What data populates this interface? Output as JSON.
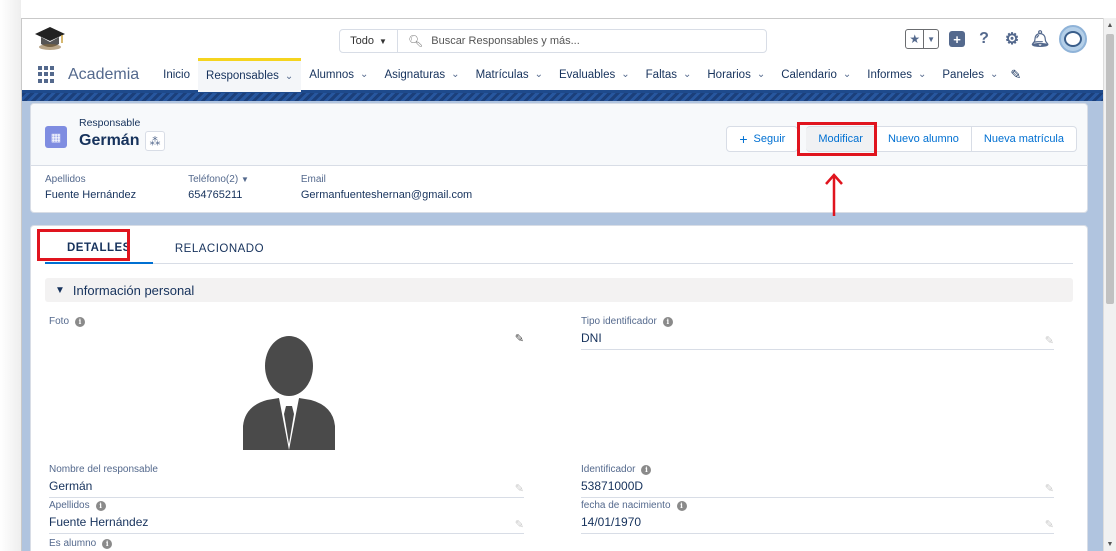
{
  "header": {
    "search_scope": "Todo",
    "search_placeholder": "Buscar Responsables y más..."
  },
  "nav": {
    "app_name": "Academia",
    "items": [
      {
        "label": "Inicio",
        "has_menu": false,
        "active": false
      },
      {
        "label": "Responsables",
        "has_menu": true,
        "active": true
      },
      {
        "label": "Alumnos",
        "has_menu": true,
        "active": false
      },
      {
        "label": "Asignaturas",
        "has_menu": true,
        "active": false
      },
      {
        "label": "Matrículas",
        "has_menu": true,
        "active": false
      },
      {
        "label": "Evaluables",
        "has_menu": true,
        "active": false
      },
      {
        "label": "Faltas",
        "has_menu": true,
        "active": false
      },
      {
        "label": "Horarios",
        "has_menu": true,
        "active": false
      },
      {
        "label": "Calendario",
        "has_menu": true,
        "active": false
      },
      {
        "label": "Informes",
        "has_menu": true,
        "active": false
      },
      {
        "label": "Paneles",
        "has_menu": true,
        "active": false
      }
    ]
  },
  "record": {
    "object_type": "Responsable",
    "name": "Germán",
    "actions": {
      "follow": "Seguir",
      "modify": "Modificar",
      "new_student": "Nuevo alumno",
      "new_enrollment": "Nueva matrícula"
    },
    "highlights": [
      {
        "label": "Apellidos",
        "value": "Fuente Hernández"
      },
      {
        "label": "Teléfono(2)",
        "value": "654765211"
      },
      {
        "label": "Email",
        "value": "Germanfuenteshernan@gmail.com"
      }
    ]
  },
  "tabs": {
    "details": "DETALLES",
    "related": "RELACIONADO"
  },
  "section": {
    "title": "Información personal"
  },
  "fields": {
    "photo_label": "Foto",
    "id_type_label": "Tipo identificador",
    "id_type_value": "DNI",
    "name_label": "Nombre del responsable",
    "name_value": "Germán",
    "id_label": "Identificador",
    "id_value": "53871000D",
    "surname_label": "Apellidos",
    "surname_value": "Fuente Hernández",
    "birth_label": "fecha de nacimiento",
    "birth_value": "14/01/1970",
    "is_student_label": "Es alumno"
  },
  "colors": {
    "highlight": "#e0141e",
    "nav_active": "#f5d41f",
    "brand_blue": "#0070d2"
  }
}
